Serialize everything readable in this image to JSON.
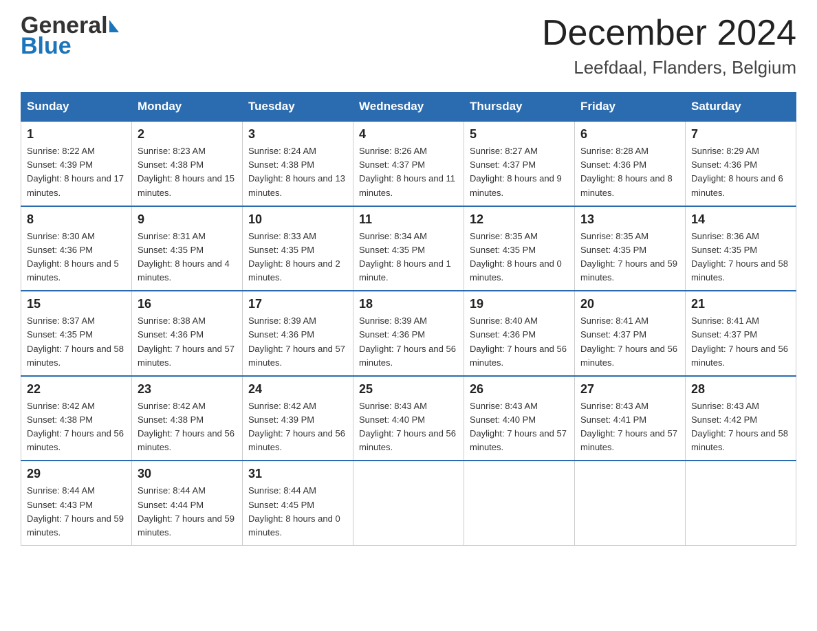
{
  "header": {
    "logo_general": "General",
    "logo_blue": "Blue",
    "month_title": "December 2024",
    "location": "Leefdaal, Flanders, Belgium"
  },
  "weekdays": [
    "Sunday",
    "Monday",
    "Tuesday",
    "Wednesday",
    "Thursday",
    "Friday",
    "Saturday"
  ],
  "weeks": [
    [
      {
        "day": "1",
        "sunrise": "8:22 AM",
        "sunset": "4:39 PM",
        "daylight": "8 hours and 17 minutes."
      },
      {
        "day": "2",
        "sunrise": "8:23 AM",
        "sunset": "4:38 PM",
        "daylight": "8 hours and 15 minutes."
      },
      {
        "day": "3",
        "sunrise": "8:24 AM",
        "sunset": "4:38 PM",
        "daylight": "8 hours and 13 minutes."
      },
      {
        "day": "4",
        "sunrise": "8:26 AM",
        "sunset": "4:37 PM",
        "daylight": "8 hours and 11 minutes."
      },
      {
        "day": "5",
        "sunrise": "8:27 AM",
        "sunset": "4:37 PM",
        "daylight": "8 hours and 9 minutes."
      },
      {
        "day": "6",
        "sunrise": "8:28 AM",
        "sunset": "4:36 PM",
        "daylight": "8 hours and 8 minutes."
      },
      {
        "day": "7",
        "sunrise": "8:29 AM",
        "sunset": "4:36 PM",
        "daylight": "8 hours and 6 minutes."
      }
    ],
    [
      {
        "day": "8",
        "sunrise": "8:30 AM",
        "sunset": "4:36 PM",
        "daylight": "8 hours and 5 minutes."
      },
      {
        "day": "9",
        "sunrise": "8:31 AM",
        "sunset": "4:35 PM",
        "daylight": "8 hours and 4 minutes."
      },
      {
        "day": "10",
        "sunrise": "8:33 AM",
        "sunset": "4:35 PM",
        "daylight": "8 hours and 2 minutes."
      },
      {
        "day": "11",
        "sunrise": "8:34 AM",
        "sunset": "4:35 PM",
        "daylight": "8 hours and 1 minute."
      },
      {
        "day": "12",
        "sunrise": "8:35 AM",
        "sunset": "4:35 PM",
        "daylight": "8 hours and 0 minutes."
      },
      {
        "day": "13",
        "sunrise": "8:35 AM",
        "sunset": "4:35 PM",
        "daylight": "7 hours and 59 minutes."
      },
      {
        "day": "14",
        "sunrise": "8:36 AM",
        "sunset": "4:35 PM",
        "daylight": "7 hours and 58 minutes."
      }
    ],
    [
      {
        "day": "15",
        "sunrise": "8:37 AM",
        "sunset": "4:35 PM",
        "daylight": "7 hours and 58 minutes."
      },
      {
        "day": "16",
        "sunrise": "8:38 AM",
        "sunset": "4:36 PM",
        "daylight": "7 hours and 57 minutes."
      },
      {
        "day": "17",
        "sunrise": "8:39 AM",
        "sunset": "4:36 PM",
        "daylight": "7 hours and 57 minutes."
      },
      {
        "day": "18",
        "sunrise": "8:39 AM",
        "sunset": "4:36 PM",
        "daylight": "7 hours and 56 minutes."
      },
      {
        "day": "19",
        "sunrise": "8:40 AM",
        "sunset": "4:36 PM",
        "daylight": "7 hours and 56 minutes."
      },
      {
        "day": "20",
        "sunrise": "8:41 AM",
        "sunset": "4:37 PM",
        "daylight": "7 hours and 56 minutes."
      },
      {
        "day": "21",
        "sunrise": "8:41 AM",
        "sunset": "4:37 PM",
        "daylight": "7 hours and 56 minutes."
      }
    ],
    [
      {
        "day": "22",
        "sunrise": "8:42 AM",
        "sunset": "4:38 PM",
        "daylight": "7 hours and 56 minutes."
      },
      {
        "day": "23",
        "sunrise": "8:42 AM",
        "sunset": "4:38 PM",
        "daylight": "7 hours and 56 minutes."
      },
      {
        "day": "24",
        "sunrise": "8:42 AM",
        "sunset": "4:39 PM",
        "daylight": "7 hours and 56 minutes."
      },
      {
        "day": "25",
        "sunrise": "8:43 AM",
        "sunset": "4:40 PM",
        "daylight": "7 hours and 56 minutes."
      },
      {
        "day": "26",
        "sunrise": "8:43 AM",
        "sunset": "4:40 PM",
        "daylight": "7 hours and 57 minutes."
      },
      {
        "day": "27",
        "sunrise": "8:43 AM",
        "sunset": "4:41 PM",
        "daylight": "7 hours and 57 minutes."
      },
      {
        "day": "28",
        "sunrise": "8:43 AM",
        "sunset": "4:42 PM",
        "daylight": "7 hours and 58 minutes."
      }
    ],
    [
      {
        "day": "29",
        "sunrise": "8:44 AM",
        "sunset": "4:43 PM",
        "daylight": "7 hours and 59 minutes."
      },
      {
        "day": "30",
        "sunrise": "8:44 AM",
        "sunset": "4:44 PM",
        "daylight": "7 hours and 59 minutes."
      },
      {
        "day": "31",
        "sunrise": "8:44 AM",
        "sunset": "4:45 PM",
        "daylight": "8 hours and 0 minutes."
      },
      null,
      null,
      null,
      null
    ]
  ]
}
